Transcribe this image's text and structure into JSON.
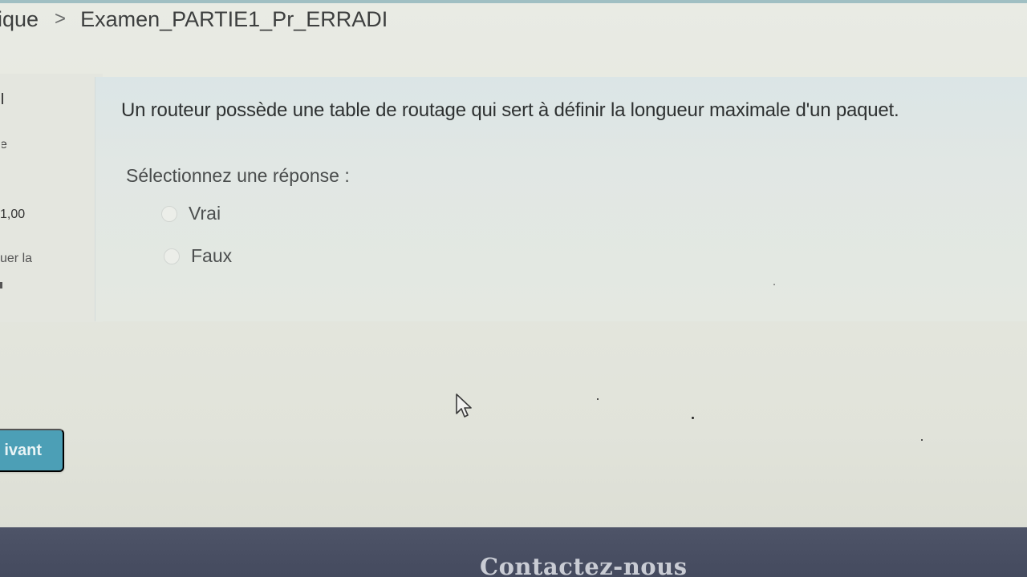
{
  "breadcrumb": {
    "previous": "ique",
    "separator": ">",
    "current": "Examen_PARTIE1_Pr_ERRADI"
  },
  "info_panel": {
    "status_fragment": "e",
    "mark_fragment": "1,00",
    "flag_fragment": "uer la"
  },
  "question": {
    "text": "Un routeur possède une table de routage qui sert à définir la longueur maximale d'un paquet.",
    "prompt": "Sélectionnez une réponse :",
    "options": [
      {
        "label": "Vrai",
        "selected": false
      },
      {
        "label": "Faux",
        "selected": false
      }
    ]
  },
  "navigation": {
    "next_label": "ivant"
  },
  "footer": {
    "contact_label": "Contactez-nous"
  },
  "colors": {
    "accent": "#4c9fb6",
    "footer_bg": "#4e5468",
    "page_bg": "#e7e8e1"
  },
  "icons": {
    "breadcrumb_separator": "chevron-right-icon",
    "cursor": "mouse-pointer-icon",
    "radio": "radio-button-icon"
  }
}
